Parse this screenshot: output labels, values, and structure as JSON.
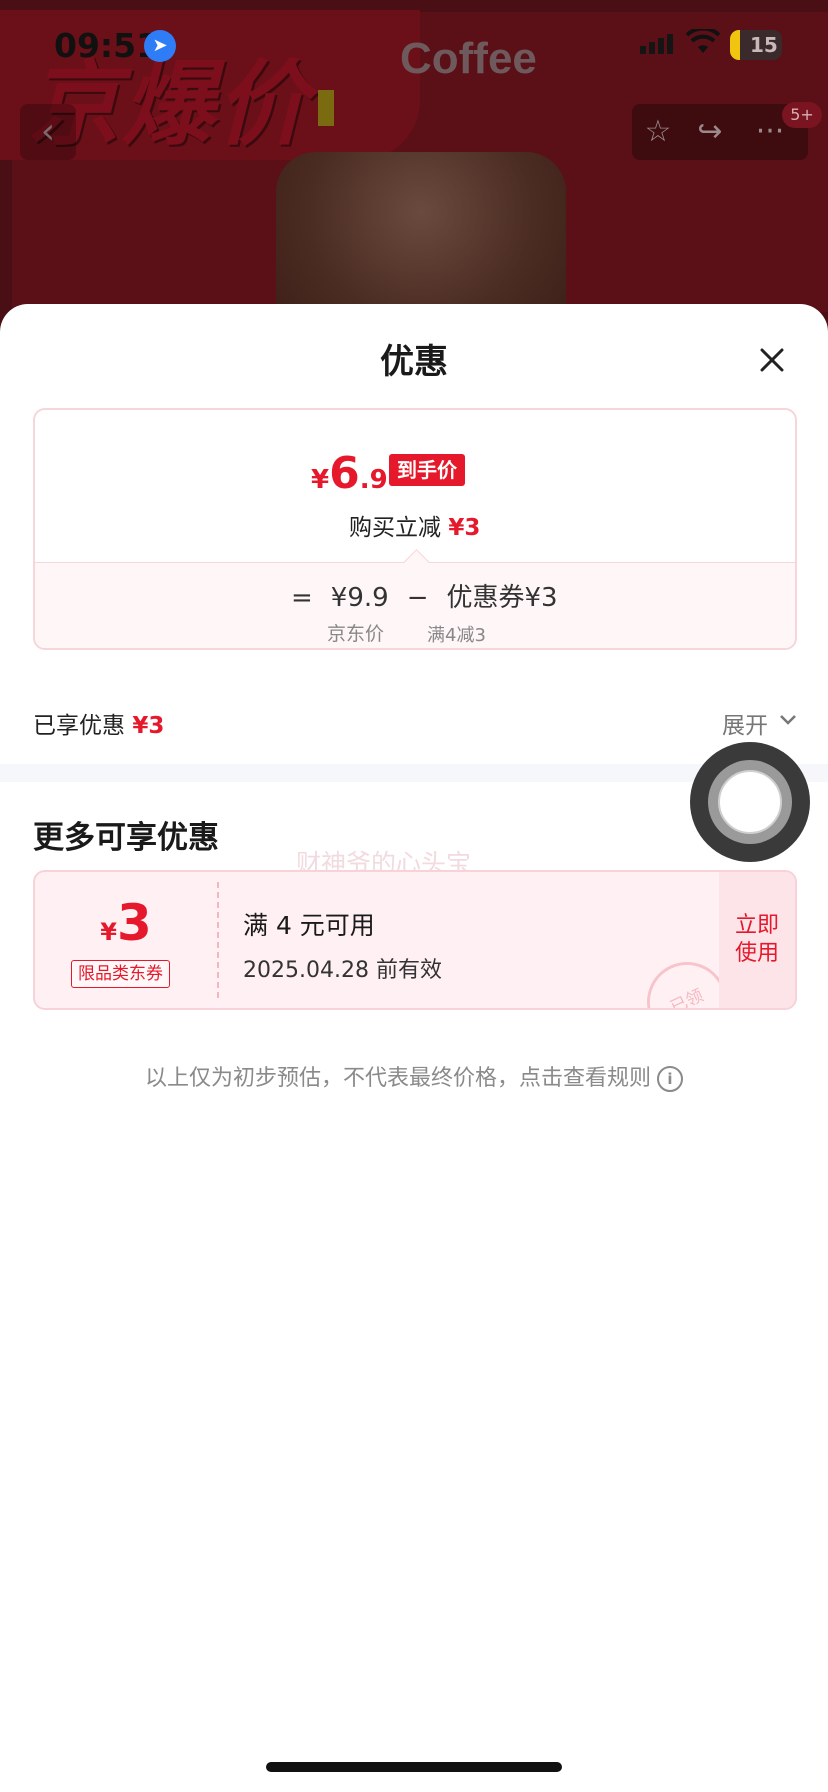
{
  "status_bar": {
    "time": "09:51",
    "battery": "15"
  },
  "background": {
    "promo_text": "京爆价",
    "product_word": "Coffee",
    "cart_badge": "5+"
  },
  "sheet": {
    "title": "优惠",
    "price": {
      "yen": "¥",
      "main": "6",
      "decimal": ".9",
      "tag": "到手价",
      "sub_label": "购买立减",
      "sub_amount": "¥3",
      "formula": {
        "equals": "=",
        "jd_price": "¥9.9",
        "minus": "−",
        "coupon": "优惠券¥3",
        "jd_price_label": "京东价",
        "coupon_label": "满4减3"
      }
    },
    "enjoyed": {
      "label": "已享优惠",
      "amount": "¥3"
    },
    "expand_label": "展开",
    "more": {
      "title": "更多可享优惠",
      "watermark": "财神爷的心头宝",
      "coupon": {
        "yen": "¥",
        "amount": "3",
        "type": "限品类东券",
        "condition": "满 4 元可用",
        "validity": "2025.04.28 前有效",
        "action_line1": "立即",
        "action_line2": "使用",
        "stamp": "已领"
      }
    },
    "disclaimer": "以上仅为初步预估，不代表最终价格，点击查看规则"
  },
  "colors": {
    "accent": "#e5192b",
    "sheet_bg": "#ffffff",
    "dim_bg": "#4a0f14"
  }
}
